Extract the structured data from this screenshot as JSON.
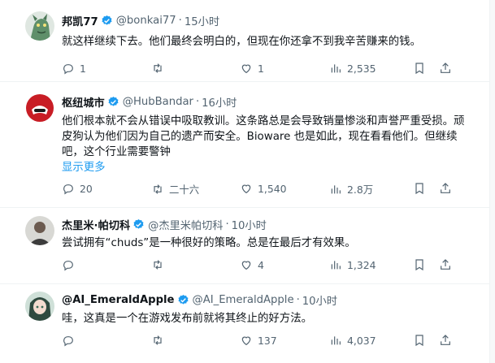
{
  "tweets": [
    {
      "name": "邦凯77",
      "handle": "@bonkai77",
      "time": "15小时",
      "text": "就这样继续下去。他们最终会明白的，但现在你还拿不到我辛苦赚来的钱。",
      "show_more": "",
      "reply_count": "1",
      "retweet_count": "",
      "like_count": "1",
      "views": "2,535",
      "avatar": "dragon-avatar"
    },
    {
      "name": "枢纽城市",
      "handle": "@HubBandar",
      "time": "16小时",
      "text": "他们根本就不会从错误中吸取教训。这条路总是会导致销量惨淡和声誉严重受损。顽皮狗认为他们因为自己的遗产而安全。Bioware 也是如此，现在看看他们。但继续吧，这个行业需要警钟",
      "show_more": "显示更多",
      "reply_count": "20",
      "retweet_count": "二十六",
      "like_count": "1,540",
      "views": "2.8万",
      "avatar": "red-helmet-avatar"
    },
    {
      "name": "杰里米·帕切科",
      "handle": "@杰里米帕切科",
      "time": "10小时",
      "text": "尝试拥有“chuds”是一种很好的策略。总是在最后才有效果。",
      "show_more": "",
      "reply_count": "",
      "retweet_count": "",
      "like_count": "4",
      "views": "1,324",
      "avatar": "portrait-avatar"
    },
    {
      "name": "@AI_EmeraldApple",
      "handle": "@AI_EmeraldApple",
      "time": "10小时",
      "text": "哇，这真是一个在游戏发布前就将其终止的好方法。",
      "show_more": "",
      "reply_count": "",
      "retweet_count": "",
      "like_count": "137",
      "views": "4,037",
      "avatar": "anime-girl-avatar"
    }
  ],
  "separator": "·",
  "colors": {
    "text": "#0f1419",
    "secondary": "#536471",
    "link": "#1d9bf0",
    "verified": "#1d9bf0",
    "divider": "#eff3f4"
  }
}
